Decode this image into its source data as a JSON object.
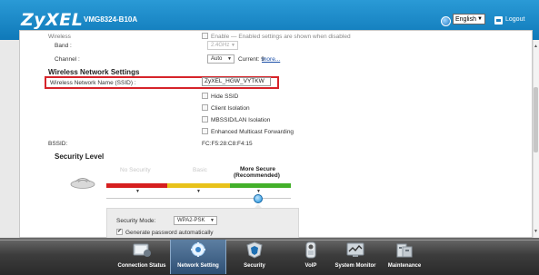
{
  "header": {
    "logo": "ZyXEL",
    "model": "VMG8324-B10A",
    "language": "English",
    "logout": "Logout"
  },
  "top_partial": {
    "label": "Wireless",
    "text": "Enable — Enabled settings are shown when disabled"
  },
  "band": {
    "label": "Band :",
    "value": "2.4GHz"
  },
  "channel": {
    "label": "Channel :",
    "value": "Auto",
    "current": "Current: 9",
    "more": "more..."
  },
  "wireless_network_settings": {
    "heading": "Wireless Network Settings",
    "ssid_label": "Wireless Network Name (SSID) :",
    "ssid_value": "ZyXEL_HGW_VYTKW",
    "options": [
      "Hide SSID",
      "Client Isolation",
      "MBSSID/LAN Isolation",
      "Enhanced Multicast Forwarding"
    ],
    "bssid_label": "BSSID:",
    "bssid_value": "FC:F5:28:C8:F4:15"
  },
  "security": {
    "heading": "Security Level",
    "levels": [
      "No Security",
      "Basic",
      "More Secure",
      "(Recommended)"
    ],
    "mode_label": "Security Mode:",
    "mode_value": "WPA2-PSK",
    "generate_label": "Generate password automatically",
    "colors": {
      "red": "#d61f1f",
      "yellow": "#e8c21a",
      "green": "#43b02a"
    }
  },
  "dock": [
    {
      "label": "Connection Status",
      "icon": "connection-status-icon"
    },
    {
      "label": "Network Setting",
      "icon": "network-setting-icon"
    },
    {
      "label": "Security",
      "icon": "security-icon"
    },
    {
      "label": "VoIP",
      "icon": "voip-icon"
    },
    {
      "label": "System Monitor",
      "icon": "system-monitor-icon"
    },
    {
      "label": "Maintenance",
      "icon": "maintenance-icon"
    }
  ]
}
